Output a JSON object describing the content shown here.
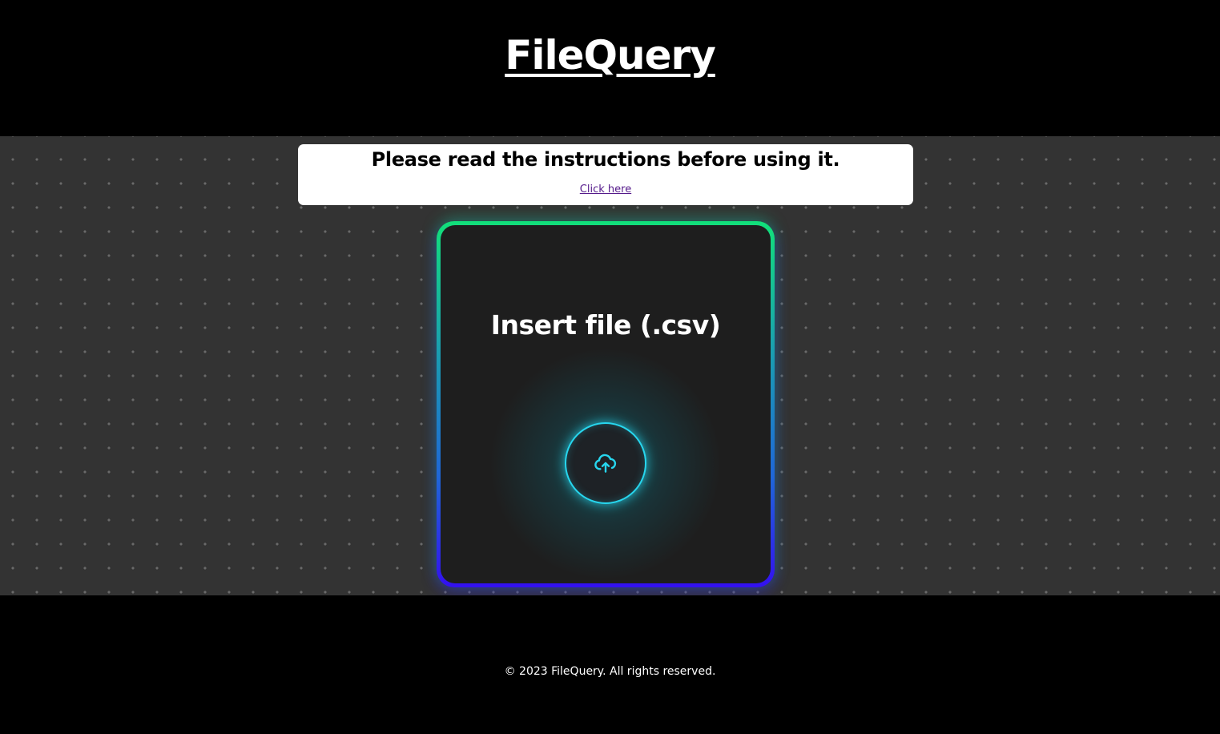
{
  "header": {
    "title": "FileQuery"
  },
  "notice": {
    "text": "Please read the instructions before using it.",
    "link_label": "Click here"
  },
  "upload_card": {
    "title": "Insert file (.csv)",
    "icon": "cloud-upload-icon"
  },
  "footer": {
    "copyright": "© 2023 FileQuery. All rights reserved."
  },
  "colors": {
    "accent_glow": "#27d6ee",
    "border_top": "#12e07a",
    "border_bottom": "#3310f0",
    "link": "#551a8b"
  }
}
